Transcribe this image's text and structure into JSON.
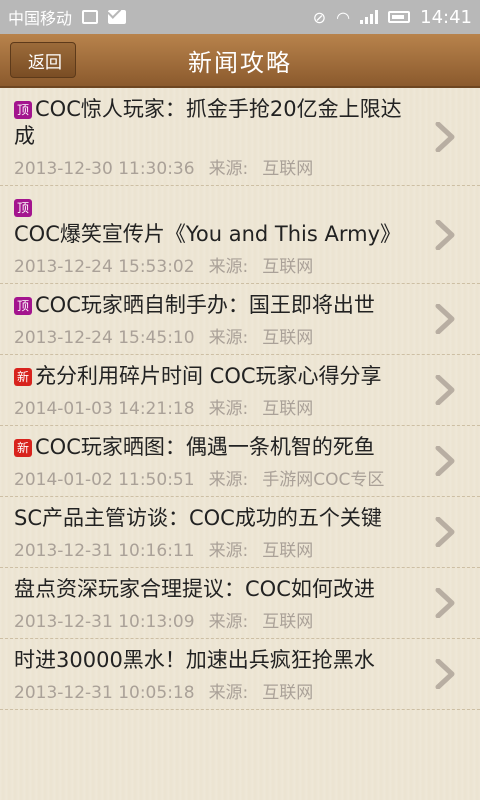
{
  "statusbar": {
    "carrier": "中国移动",
    "time": "14:41"
  },
  "header": {
    "back_label": "返回",
    "title": "新闻攻略"
  },
  "items": [
    {
      "badge": "顶",
      "badge_type": "top",
      "title": "COC惊人玩家：抓金手抢20亿金上限达成",
      "date": "2013-12-30 11:30:36",
      "source_label": "来源:",
      "source": "互联网"
    },
    {
      "badge": "顶",
      "badge_type": "top",
      "title": "COC爆笑宣传片《You and This Army》",
      "date": "2013-12-24 15:53:02",
      "source_label": "来源:",
      "source": "互联网"
    },
    {
      "badge": "顶",
      "badge_type": "top",
      "title": "COC玩家晒自制手办：国王即将出世",
      "date": "2013-12-24 15:45:10",
      "source_label": "来源:",
      "source": "互联网"
    },
    {
      "badge": "新",
      "badge_type": "new",
      "title": "充分利用碎片时间 COC玩家心得分享",
      "date": "2014-01-03 14:21:18",
      "source_label": "来源:",
      "source": "互联网"
    },
    {
      "badge": "新",
      "badge_type": "new",
      "title": "COC玩家晒图：偶遇一条机智的死鱼",
      "date": "2014-01-02 11:50:51",
      "source_label": "来源:",
      "source": "手游网COC专区"
    },
    {
      "badge": "",
      "badge_type": "",
      "title": "SC产品主管访谈：COC成功的五个关键",
      "date": "2013-12-31 10:16:11",
      "source_label": "来源:",
      "source": "互联网"
    },
    {
      "badge": "",
      "badge_type": "",
      "title": "盘点资深玩家合理提议：COC如何改进",
      "date": "2013-12-31 10:13:09",
      "source_label": "来源:",
      "source": "互联网"
    },
    {
      "badge": "",
      "badge_type": "",
      "title": "时进30000黑水！加速出兵疯狂抢黑水",
      "date": "2013-12-31 10:05:18",
      "source_label": "来源:",
      "source": "互联网"
    }
  ]
}
